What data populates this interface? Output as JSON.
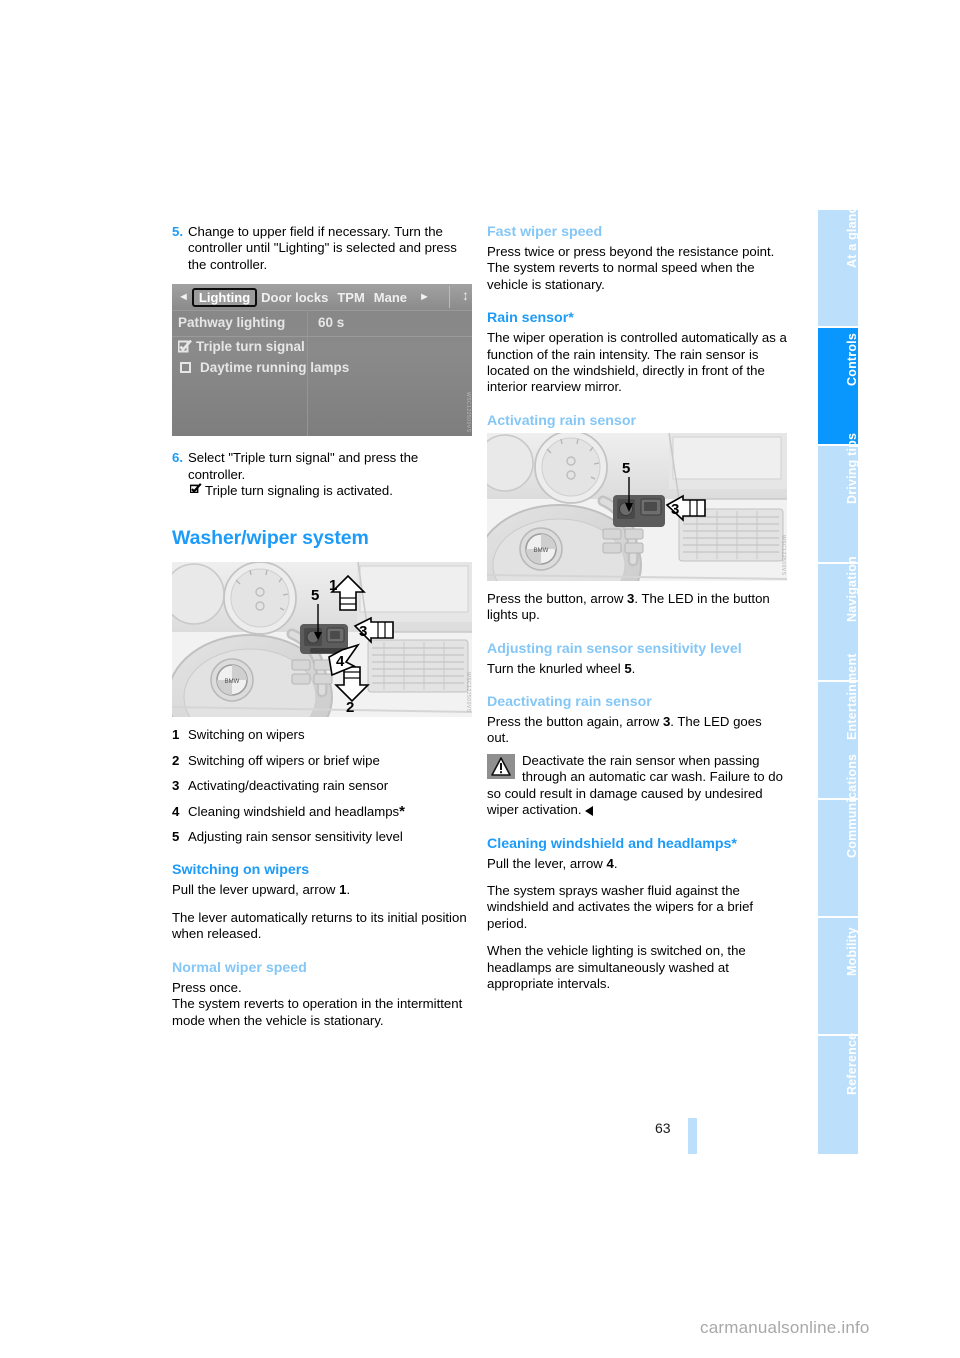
{
  "page": {
    "number": "63",
    "watermark": "carmanualsonline.info"
  },
  "sidebar": {
    "tabs": [
      {
        "label": "At a glance",
        "active": false
      },
      {
        "label": "Controls",
        "active": true
      },
      {
        "label": "Driving tips",
        "active": false
      },
      {
        "label": "Navigation",
        "active": false
      },
      {
        "label": "Entertainment",
        "active": false
      },
      {
        "label": "Communications",
        "active": false
      },
      {
        "label": "Mobility",
        "active": false
      },
      {
        "label": "Reference",
        "active": false
      }
    ],
    "active_color": "#0a97fd",
    "inactive_color": "#bcdffb"
  },
  "left_column": {
    "step5": {
      "num": "5.",
      "text": "Change to upper field if necessary. Turn the controller until \"Lighting\" is selected and press the controller."
    },
    "idrive": {
      "menu_items": [
        "Lighting",
        "Door locks",
        "TPM",
        "Mane"
      ],
      "selected_menu": "Lighting",
      "rows": [
        {
          "label": "Pathway lighting",
          "value": "60 s",
          "checkbox": "none"
        },
        {
          "label": "Triple turn signal",
          "value": "",
          "checkbox": "checked"
        },
        {
          "label": "Daytime running lamps",
          "value": "",
          "checkbox": "unchecked"
        }
      ]
    },
    "step6": {
      "num": "6.",
      "text": "Select \"Triple turn signal\" and press the controller.",
      "result": "Triple turn signaling is activated."
    },
    "section_title": "Washer/wiper system",
    "legend": [
      {
        "num": "1",
        "text": "Switching on wipers",
        "star": false
      },
      {
        "num": "2",
        "text": "Switching off wipers or brief wipe",
        "star": false
      },
      {
        "num": "3",
        "text": "Activating/deactivating rain sensor",
        "star": false
      },
      {
        "num": "4",
        "text": "Cleaning windshield and headlamps",
        "star": true
      },
      {
        "num": "5",
        "text": "Adjusting rain sensor sensitivity level",
        "star": false
      }
    ],
    "switching_on": {
      "heading": "Switching on wipers",
      "p1_a": "Pull the lever upward, arrow ",
      "p1_b": "1",
      "p1_c": ".",
      "p2": "The lever automatically returns to its initial position when released."
    },
    "normal_speed": {
      "heading": "Normal wiper speed",
      "p1": "Press once.",
      "p2": "The system reverts to operation in the intermittent mode when the vehicle is stationary."
    }
  },
  "right_column": {
    "fast_speed": {
      "heading": "Fast wiper speed",
      "p1": "Press twice or press beyond the resistance point.",
      "p2": "The system reverts to normal speed when the vehicle is stationary."
    },
    "rain_sensor": {
      "heading": "Rain sensor*",
      "p1": "The wiper operation is controlled automatically as a function of the rain intensity. The rain sensor is located on the windshield, directly in front of the interior rearview mirror."
    },
    "activating": {
      "heading": "Activating rain sensor",
      "p1_a": "Press the button, arrow ",
      "p1_b": "3",
      "p1_c": ". The LED in the button lights up."
    },
    "adjusting": {
      "heading": "Adjusting rain sensor sensitivity level",
      "p1_a": "Turn the knurled wheel ",
      "p1_b": "5",
      "p1_c": "."
    },
    "deactivating": {
      "heading": "Deactivating rain sensor",
      "p1_a": "Press the button again, arrow ",
      "p1_b": "3",
      "p1_c": ". The LED goes out.",
      "warning": "Deactivate the rain sensor when passing through an automatic car wash. Failure to do so could result in damage caused by undesired wiper activation."
    },
    "cleaning": {
      "heading": "Cleaning windshield and headlamps*",
      "p1_a": "Pull the lever, arrow ",
      "p1_b": "4",
      "p1_c": ".",
      "p2": "The system sprays washer fluid against the windshield and activates the wipers for a brief period.",
      "p3": "When the vehicle lighting is switched on, the headlamps are simultaneously washed at appropriate intervals."
    }
  },
  "figures": {
    "wiper_stalk": {
      "callouts": [
        "1",
        "2",
        "3",
        "4",
        "5"
      ],
      "watermark": "WSC122500VS"
    },
    "rain_sensor_button": {
      "callouts": [
        "3",
        "5"
      ],
      "watermark": "WSC122500VS"
    }
  },
  "colors": {
    "heading_blue": "#1d9bf8",
    "subheading_blue": "#84c7f7",
    "tab_light": "#bcdffb",
    "tab_active": "#0a97fd"
  }
}
